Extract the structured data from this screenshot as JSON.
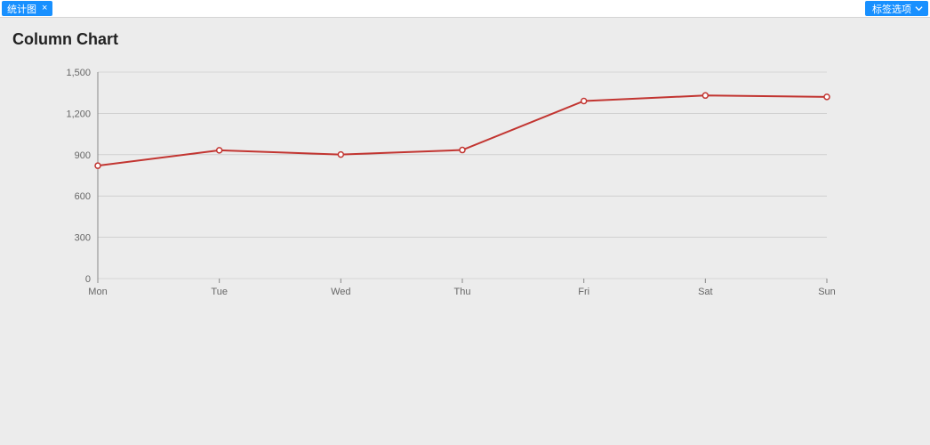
{
  "topbar": {
    "tab_label": "统计图",
    "tab_close": "×",
    "options_label": "标签选项"
  },
  "title": "Column Chart",
  "chart_data": {
    "type": "line",
    "title": "Column Chart",
    "xlabel": "",
    "ylabel": "",
    "categories": [
      "Mon",
      "Tue",
      "Wed",
      "Thu",
      "Fri",
      "Sat",
      "Sun"
    ],
    "values": [
      820,
      932,
      901,
      934,
      1290,
      1330,
      1320
    ],
    "y_ticks": [
      0,
      300,
      600,
      900,
      1200,
      1500
    ],
    "ylim": [
      0,
      1500
    ],
    "grid": true,
    "legend": false,
    "series_color": "#c23531"
  }
}
